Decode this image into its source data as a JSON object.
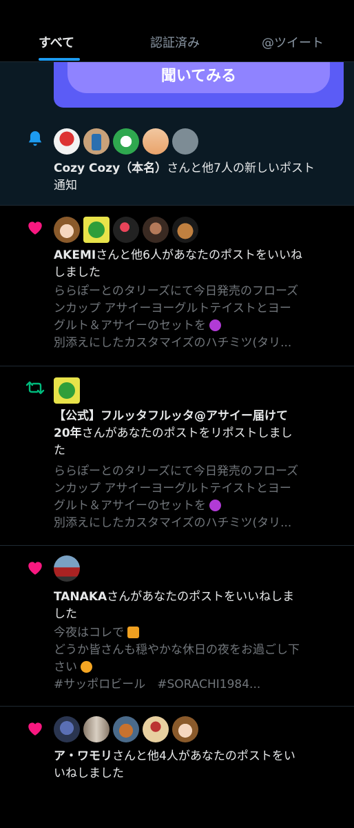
{
  "tabs": [
    {
      "label": "すべて",
      "active": true
    },
    {
      "label": "認証済み",
      "active": false
    },
    {
      "label": "@ツイート",
      "active": false
    }
  ],
  "banner": {
    "cta_label": "聞いてみる"
  },
  "notifications": [
    {
      "kind": "bell-icon",
      "actor": "Cozy Cozy（本名）",
      "title_line1_rest": "さんと他7人の新しいポ",
      "title_line1_tail": "スト",
      "title_line2": "通知"
    },
    {
      "kind": "heart-icon",
      "actor": "AKEMI",
      "title_line1_rest": "さんと他6人があなたのポストをいいね",
      "title_line2": "しました",
      "snippet": [
        "ららぽーとのタリーズにて今日発売のフローズ",
        "ンカップ アサイーヨーグルトテイストとヨー",
        "グルト＆アサイーのセットを",
        "別添えにしたカスタマイズのハチミツ(タリ..."
      ]
    },
    {
      "kind": "repost-icon",
      "title_line1": "【公式】フルッタフルッタ@アサイー届けて",
      "title_line2_bold": "20年",
      "title_line2_rest": "さんがあなたのポストをリポストしまし",
      "title_line3": "た",
      "snippet": [
        "ららぽーとのタリーズにて今日発売のフローズ",
        "ンカップ アサイーヨーグルトテイストとヨー",
        "グルト＆アサイーのセットを",
        "別添えにしたカスタマイズのハチミツ(タリ..."
      ]
    },
    {
      "kind": "heart-icon",
      "actor": "TANAKA",
      "title_line1_rest": "さんがあなたのポストをいいねしま",
      "title_line2": "した",
      "snippet": [
        "今夜はコレで",
        "どうか皆さんも穏やかな休日の夜をお過ごし下",
        "さい",
        "#サッポロビール　#SORACHI1984..."
      ]
    },
    {
      "kind": "heart-icon",
      "actor": "ア・ワモリ",
      "title_line1_rest": "さんと他4人があなたのポストをい",
      "title_line2": "いねしました"
    }
  ],
  "colors": {
    "accent": "#1d9bf0",
    "like": "#f91880",
    "repost": "#00ba7c",
    "muted": "#71767b"
  }
}
